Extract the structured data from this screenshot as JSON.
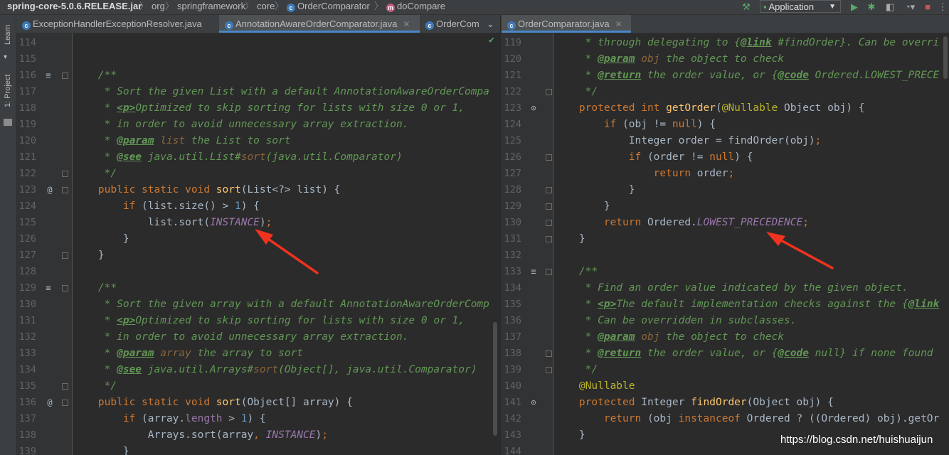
{
  "breadcrumb": {
    "jar": "spring-core-5.0.6.RELEASE.jar",
    "items": [
      "org",
      "springframework",
      "core",
      "OrderComparator",
      "doCompare"
    ]
  },
  "toolbar": {
    "run_config": "Application"
  },
  "toolstrip": {
    "learn": "Learn",
    "project": "1: Project"
  },
  "left_tabs": [
    "ExceptionHandlerExceptionResolver.java",
    "AnnotationAwareOrderComparator.java",
    "OrderCom"
  ],
  "right_tabs": [
    "OrderComparator.java"
  ],
  "watermark": "https://blog.csdn.net/huishuaijun",
  "left_lines": [
    {
      "n": "114",
      "t": []
    },
    {
      "n": "115",
      "t": []
    },
    {
      "n": "116",
      "t": [
        [
          "cm",
          "    /**"
        ]
      ]
    },
    {
      "n": "117",
      "t": [
        [
          "cm",
          "     * Sort the given List with a default AnnotationAwareOrderCompa"
        ]
      ]
    },
    {
      "n": "118",
      "t": [
        [
          "cm",
          "     * "
        ],
        [
          "tag",
          "<p>"
        ],
        [
          "cm",
          "Optimized to skip sorting for lists with size 0 or 1,"
        ]
      ]
    },
    {
      "n": "119",
      "t": [
        [
          "cm",
          "     * in order to avoid unnecessary array extraction."
        ]
      ]
    },
    {
      "n": "120",
      "t": [
        [
          "cm",
          "     * "
        ],
        [
          "tag",
          "@param"
        ],
        [
          "tagref",
          " list"
        ],
        [
          "cm",
          " the List to sort"
        ]
      ]
    },
    {
      "n": "121",
      "t": [
        [
          "cm",
          "     * "
        ],
        [
          "tag",
          "@see"
        ],
        [
          "cm",
          " java.util.List#"
        ],
        [
          "tagref",
          "sort"
        ],
        [
          "cm",
          "(java.util.Comparator)"
        ]
      ]
    },
    {
      "n": "122",
      "t": [
        [
          "cm",
          "     */"
        ]
      ]
    },
    {
      "n": "123",
      "t": [
        [
          "kw",
          "    public static void "
        ],
        [
          "fn",
          "sort"
        ],
        [
          "pl",
          "(List<?> list) {"
        ]
      ]
    },
    {
      "n": "124",
      "t": [
        [
          "kw",
          "        if "
        ],
        [
          "pl",
          "(list.size() > "
        ],
        [
          "num",
          "1"
        ],
        [
          "pl",
          ") {"
        ]
      ]
    },
    {
      "n": "125",
      "t": [
        [
          "pl",
          "            list.sort("
        ],
        [
          "sf",
          "INSTANCE"
        ],
        [
          "pl",
          ")"
        ],
        [
          "kw",
          ";"
        ]
      ]
    },
    {
      "n": "126",
      "t": [
        [
          "pl",
          "        }"
        ]
      ]
    },
    {
      "n": "127",
      "t": [
        [
          "pl",
          "    }"
        ]
      ]
    },
    {
      "n": "128",
      "t": []
    },
    {
      "n": "129",
      "t": [
        [
          "cm",
          "    /**"
        ]
      ]
    },
    {
      "n": "130",
      "t": [
        [
          "cm",
          "     * Sort the given array with a default AnnotationAwareOrderComp"
        ]
      ]
    },
    {
      "n": "131",
      "t": [
        [
          "cm",
          "     * "
        ],
        [
          "tag",
          "<p>"
        ],
        [
          "cm",
          "Optimized to skip sorting for lists with size 0 or 1,"
        ]
      ]
    },
    {
      "n": "132",
      "t": [
        [
          "cm",
          "     * in order to avoid unnecessary array extraction."
        ]
      ]
    },
    {
      "n": "133",
      "t": [
        [
          "cm",
          "     * "
        ],
        [
          "tag",
          "@param"
        ],
        [
          "tagref",
          " array"
        ],
        [
          "cm",
          " the array to sort"
        ]
      ]
    },
    {
      "n": "134",
      "t": [
        [
          "cm",
          "     * "
        ],
        [
          "tag",
          "@see"
        ],
        [
          "cm",
          " java.util.Arrays#"
        ],
        [
          "tagref",
          "sort"
        ],
        [
          "cm",
          "(Object[], java.util.Comparator)"
        ]
      ]
    },
    {
      "n": "135",
      "t": [
        [
          "cm",
          "     */"
        ]
      ]
    },
    {
      "n": "136",
      "t": [
        [
          "kw",
          "    public static void "
        ],
        [
          "fn",
          "sort"
        ],
        [
          "pl",
          "(Object[] array) {"
        ]
      ]
    },
    {
      "n": "137",
      "t": [
        [
          "kw",
          "        if "
        ],
        [
          "pl",
          "(array."
        ],
        [
          "fld",
          "length"
        ],
        [
          "pl",
          " > "
        ],
        [
          "num",
          "1"
        ],
        [
          "pl",
          ") {"
        ]
      ]
    },
    {
      "n": "138",
      "t": [
        [
          "pl",
          "            Arrays.sort(array"
        ],
        [
          "kw",
          ", "
        ],
        [
          "sf",
          "INSTANCE"
        ],
        [
          "pl",
          ")"
        ],
        [
          "kw",
          ";"
        ]
      ]
    },
    {
      "n": "139",
      "t": [
        [
          "pl",
          "        }"
        ]
      ]
    }
  ],
  "right_lines": [
    {
      "n": "119",
      "t": [
        [
          "cm",
          "     * through delegating to {"
        ],
        [
          "tag",
          "@link"
        ],
        [
          "cm",
          " #findOrder}. Can be overri"
        ]
      ]
    },
    {
      "n": "120",
      "t": [
        [
          "cm",
          "     * "
        ],
        [
          "tag",
          "@param"
        ],
        [
          "tagref",
          " obj"
        ],
        [
          "cm",
          " the object to check"
        ]
      ]
    },
    {
      "n": "121",
      "t": [
        [
          "cm",
          "     * "
        ],
        [
          "tag",
          "@return"
        ],
        [
          "cm",
          " the order value, or {"
        ],
        [
          "tag",
          "@code"
        ],
        [
          "cm",
          " Ordered.LOWEST_PRECE"
        ]
      ]
    },
    {
      "n": "122",
      "t": [
        [
          "cm",
          "     */"
        ]
      ]
    },
    {
      "n": "123",
      "t": [
        [
          "kw",
          "    protected int "
        ],
        [
          "fn",
          "getOrder"
        ],
        [
          "pl",
          "("
        ],
        [
          "ann",
          "@Nullable"
        ],
        [
          "pl",
          " Object obj) {"
        ]
      ]
    },
    {
      "n": "124",
      "t": [
        [
          "kw",
          "        if "
        ],
        [
          "pl",
          "(obj != "
        ],
        [
          "kw",
          "null"
        ],
        [
          "pl",
          ") {"
        ]
      ]
    },
    {
      "n": "125",
      "t": [
        [
          "pl",
          "            Integer order = findOrder(obj)"
        ],
        [
          "kw",
          ";"
        ]
      ]
    },
    {
      "n": "126",
      "t": [
        [
          "kw",
          "            if "
        ],
        [
          "pl",
          "(order != "
        ],
        [
          "kw",
          "null"
        ],
        [
          "pl",
          ") {"
        ]
      ]
    },
    {
      "n": "127",
      "t": [
        [
          "kw",
          "                return "
        ],
        [
          "pl",
          "order"
        ],
        [
          "kw",
          ";"
        ]
      ]
    },
    {
      "n": "128",
      "t": [
        [
          "pl",
          "            }"
        ]
      ]
    },
    {
      "n": "129",
      "t": [
        [
          "pl",
          "        }"
        ]
      ]
    },
    {
      "n": "130",
      "t": [
        [
          "kw",
          "        return "
        ],
        [
          "pl",
          "Ordered."
        ],
        [
          "sf",
          "LOWEST_PRECEDENCE"
        ],
        [
          "kw",
          ";"
        ]
      ]
    },
    {
      "n": "131",
      "t": [
        [
          "pl",
          "    }"
        ]
      ]
    },
    {
      "n": "132",
      "t": []
    },
    {
      "n": "133",
      "t": [
        [
          "cm",
          "    /**"
        ]
      ]
    },
    {
      "n": "134",
      "t": [
        [
          "cm",
          "     * Find an order value indicated by the given object."
        ]
      ]
    },
    {
      "n": "135",
      "t": [
        [
          "cm",
          "     * "
        ],
        [
          "tag",
          "<p>"
        ],
        [
          "cm",
          "The default implementation checks against the {"
        ],
        [
          "tag",
          "@link"
        ]
      ]
    },
    {
      "n": "136",
      "t": [
        [
          "cm",
          "     * Can be overridden in subclasses."
        ]
      ]
    },
    {
      "n": "137",
      "t": [
        [
          "cm",
          "     * "
        ],
        [
          "tag",
          "@param"
        ],
        [
          "tagref",
          " obj"
        ],
        [
          "cm",
          " the object to check"
        ]
      ]
    },
    {
      "n": "138",
      "t": [
        [
          "cm",
          "     * "
        ],
        [
          "tag",
          "@return"
        ],
        [
          "cm",
          " the order value, or {"
        ],
        [
          "tag",
          "@code"
        ],
        [
          "cm",
          " null} if none found"
        ]
      ]
    },
    {
      "n": "139",
      "t": [
        [
          "cm",
          "     */"
        ]
      ]
    },
    {
      "n": "140",
      "t": [
        [
          "ann",
          "    @Nullable"
        ]
      ]
    },
    {
      "n": "141",
      "t": [
        [
          "kw",
          "    protected "
        ],
        [
          "pl",
          "Integer "
        ],
        [
          "fn",
          "findOrder"
        ],
        [
          "pl",
          "(Object obj) {"
        ]
      ]
    },
    {
      "n": "142",
      "t": [
        [
          "kw",
          "        return "
        ],
        [
          "pl",
          "(obj "
        ],
        [
          "kw",
          "instanceof "
        ],
        [
          "pl",
          "Ordered ? ((Ordered) obj).getOr"
        ]
      ]
    },
    {
      "n": "143",
      "t": [
        [
          "pl",
          "    }"
        ]
      ]
    },
    {
      "n": "144",
      "t": []
    }
  ]
}
